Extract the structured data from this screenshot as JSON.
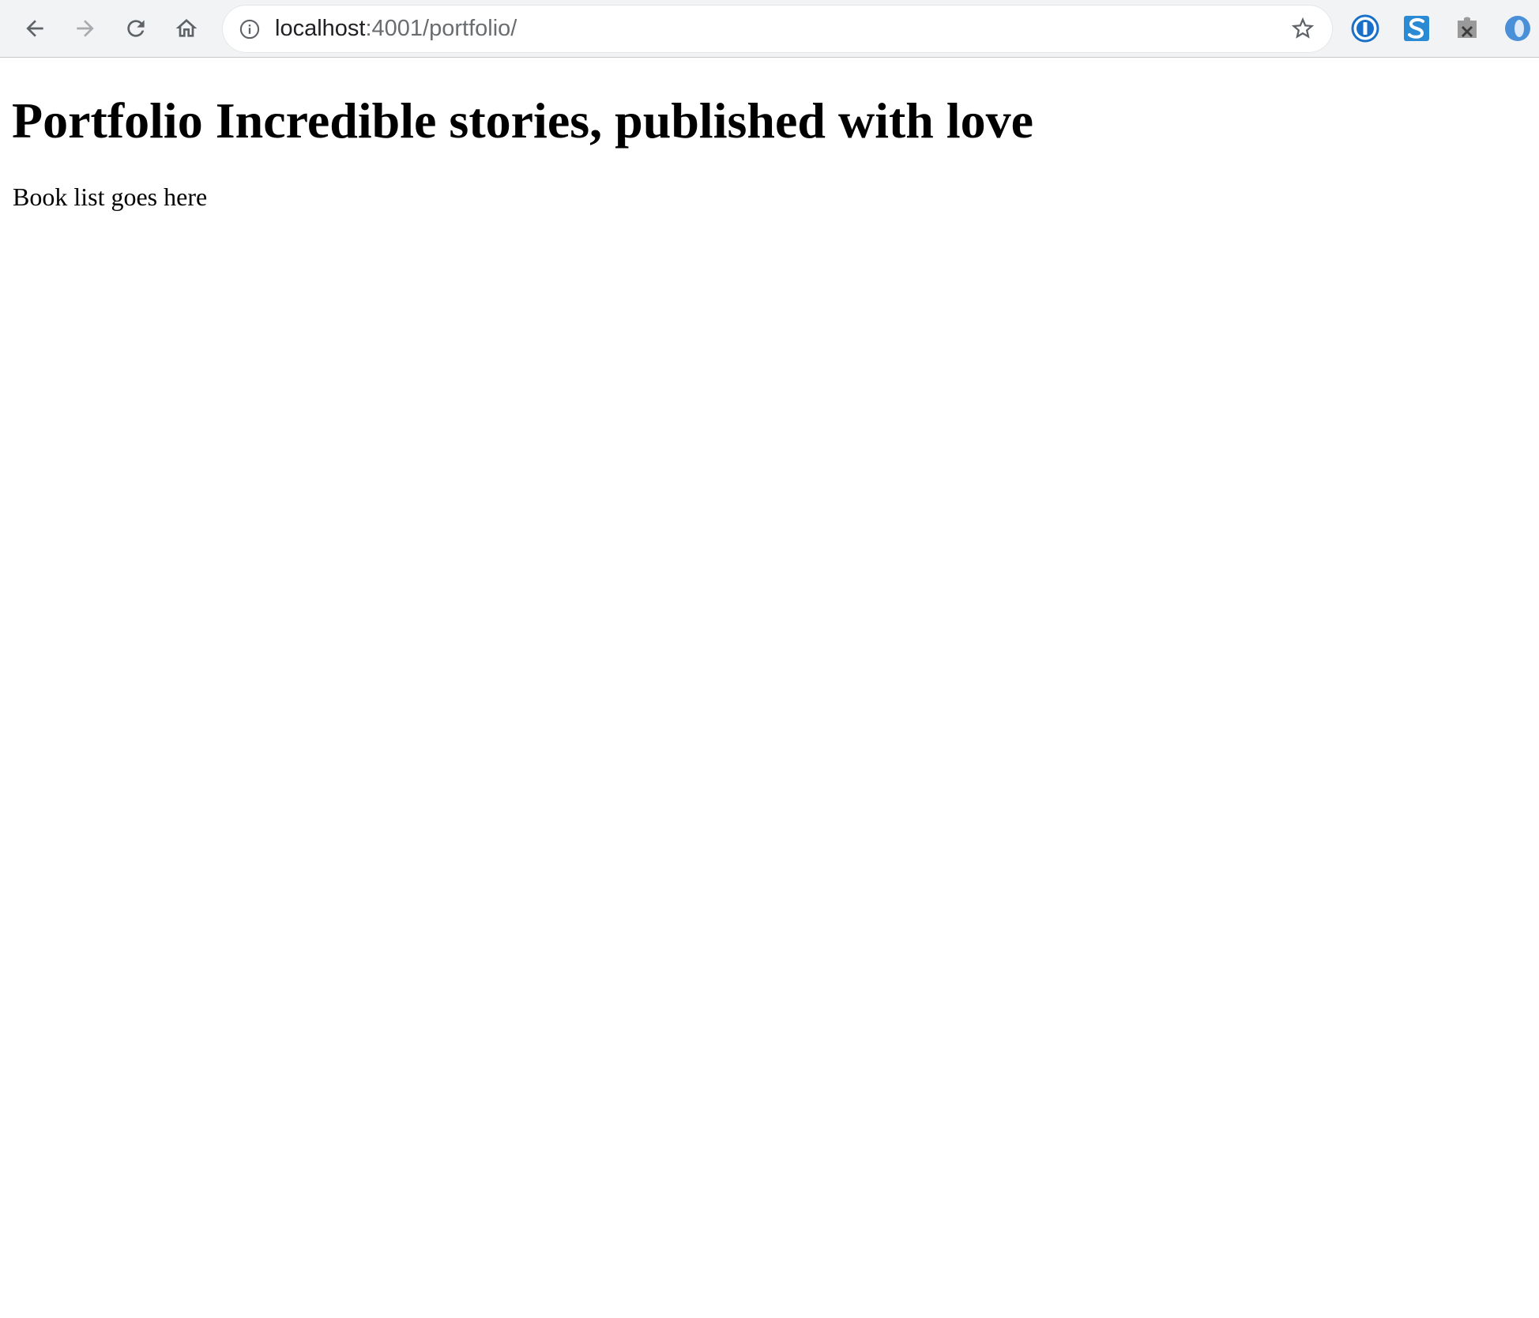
{
  "browser": {
    "url_host": "localhost",
    "url_rest": ":4001/portfolio/",
    "toolbar_bg": "#f1f3f4",
    "icons": {
      "back": "back-arrow-icon",
      "forward": "forward-arrow-icon",
      "reload": "reload-icon",
      "home": "home-icon",
      "site_info": "info-icon",
      "bookmark": "star-icon"
    },
    "extensions": [
      {
        "name": "1password-extension-icon",
        "color": "#1a6fc9"
      },
      {
        "name": "s-extension-icon",
        "color": "#2a8ad4"
      },
      {
        "name": "puzzle-x-extension-icon",
        "color": "#8a8a8a"
      },
      {
        "name": "o-extension-icon",
        "color": "#4a90d9"
      }
    ]
  },
  "page": {
    "title": "Portfolio Incredible stories, published with love",
    "body_text": "Book list goes here"
  }
}
